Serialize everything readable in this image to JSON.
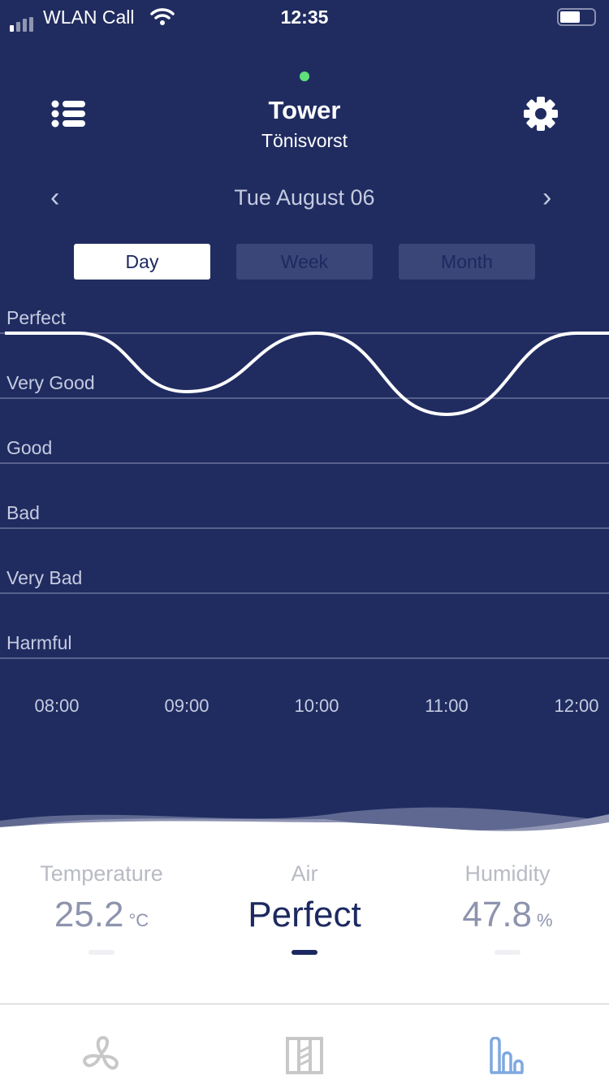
{
  "status_bar": {
    "carrier": "WLAN Call",
    "time": "12:35",
    "battery_level": 0.6
  },
  "header": {
    "connected_color": "#5ee07a",
    "title": "Tower",
    "subtitle": "Tönisvorst",
    "menu_icon": "list-icon",
    "settings_icon": "gear-icon"
  },
  "date_nav": {
    "date": "Tue August 06",
    "prev": "‹",
    "next": "›"
  },
  "range_tabs": [
    {
      "label": "Day",
      "selected": true
    },
    {
      "label": "Week",
      "selected": false
    },
    {
      "label": "Month",
      "selected": false
    }
  ],
  "chart_data": {
    "type": "line",
    "levels": [
      "Perfect",
      "Very Good",
      "Good",
      "Bad",
      "Very Bad",
      "Harmful"
    ],
    "x_ticks": [
      "08:00",
      "09:00",
      "10:00",
      "11:00",
      "12:00"
    ],
    "x": [
      "07:36",
      "08:10",
      "09:00",
      "10:00",
      "11:00",
      "12:00",
      "12:15"
    ],
    "y_level_values": [
      5,
      5,
      4.1,
      5,
      3.75,
      5,
      5
    ],
    "y_scale": "levels: Perfect=5 ... Harmful=0"
  },
  "readings": {
    "temperature": {
      "label": "Temperature",
      "value": "25.2",
      "unit": "°C"
    },
    "air": {
      "label": "Air",
      "value": "Perfect"
    },
    "humidity": {
      "label": "Humidity",
      "value": "47.8",
      "unit": "%"
    }
  },
  "colors": {
    "background": "#202c60",
    "active_tab": "#7fa8e0",
    "inactive_tab": "#c8c8c8"
  },
  "tabbar": [
    {
      "icon": "fan-icon",
      "active": false
    },
    {
      "icon": "filter-icon",
      "active": false
    },
    {
      "icon": "bar-chart-icon",
      "active": true
    }
  ]
}
